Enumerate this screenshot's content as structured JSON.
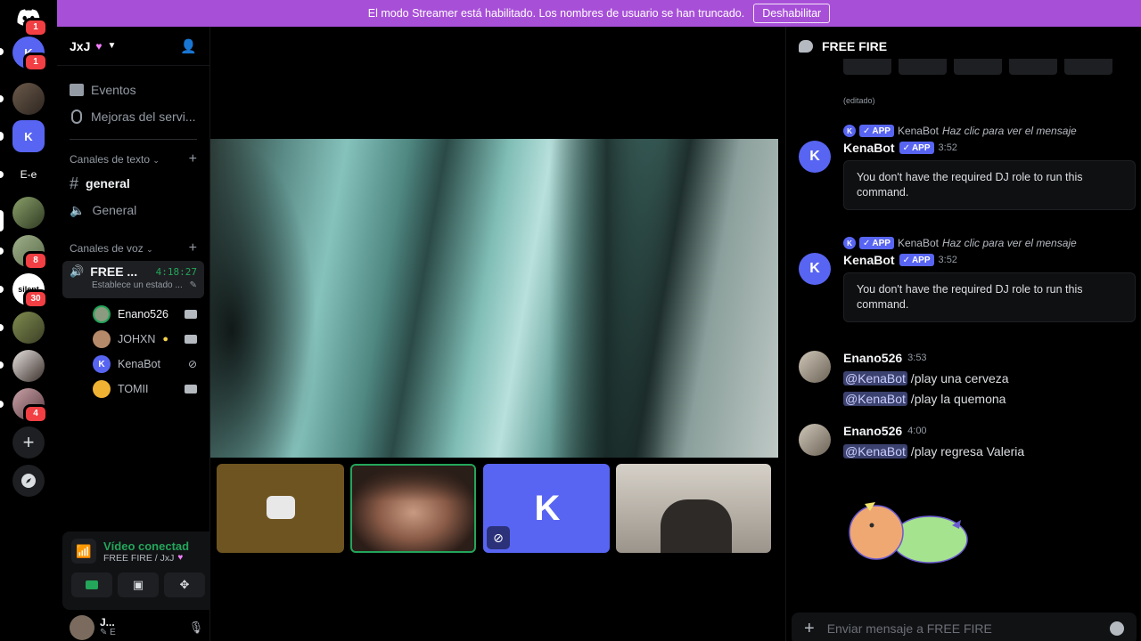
{
  "banner": {
    "text": "El modo Streamer está habilitado. Los nombres de usuario se han truncado.",
    "button": "Deshabilitar"
  },
  "rail": {
    "servers": [
      {
        "name": "discord-home",
        "badge": "1"
      },
      {
        "name": "kena-server",
        "badge": "1"
      },
      {
        "name": "server-photo-1",
        "badge": ""
      },
      {
        "name": "kena-active",
        "badge": ""
      },
      {
        "name": "e-e-server",
        "label": "E-e",
        "badge": ""
      },
      {
        "name": "server-photo-2",
        "badge": ""
      },
      {
        "name": "server-photo-3",
        "badge": "8"
      },
      {
        "name": "server-silent",
        "label": "silent",
        "badge": "30"
      },
      {
        "name": "server-photo-4",
        "badge": ""
      },
      {
        "name": "server-photo-5",
        "badge": ""
      },
      {
        "name": "server-photo-6",
        "badge": "4"
      }
    ]
  },
  "sidebar": {
    "guild_name": "JxJ",
    "events": "Eventos",
    "boosts": "Mejoras del servi...",
    "text_category": "Canales de texto",
    "text_channels": [
      {
        "name": "general"
      },
      {
        "name": "General"
      }
    ],
    "voice_category": "Canales de voz",
    "voice_channel": {
      "name": "FREE ...",
      "timer": "4:18:27",
      "status": "Establece un estado ..."
    },
    "voice_users": [
      {
        "name": "Enano526"
      },
      {
        "name": "JOHXN"
      },
      {
        "name": "KenaBot"
      },
      {
        "name": "TOMII"
      }
    ],
    "voice_panel": {
      "title": "Vídeo conectad",
      "subtitle": "FREE FIRE / JxJ"
    },
    "user": {
      "name": "J...",
      "status": "✎ E"
    }
  },
  "chat": {
    "channel": "FREE FIRE",
    "edited": "(editado)",
    "messages": [
      {
        "reply_name": "KenaBot",
        "reply_text": "Haz clic para ver el mensaje",
        "author": "KenaBot",
        "app": "APP",
        "time": "3:52",
        "embed": "You don't have the required DJ role to run this command."
      },
      {
        "reply_name": "KenaBot",
        "reply_text": "Haz clic para ver el mensaje",
        "author": "KenaBot",
        "app": "APP",
        "time": "3:52",
        "embed": "You don't have the required DJ role to run this command."
      },
      {
        "author": "Enano526",
        "time": "3:53",
        "lines": [
          {
            "mention": "@KenaBot",
            "text": " /play una cerveza"
          },
          {
            "mention": "@KenaBot",
            "text": " /play la quemona"
          }
        ]
      },
      {
        "author": "Enano526",
        "time": "4:00",
        "lines": [
          {
            "mention": "@KenaBot",
            "text": " /play regresa Valeria"
          }
        ]
      }
    ],
    "composer_placeholder": "Enviar mensaje a FREE FIRE"
  },
  "colors": {
    "banner": "#a84fd8",
    "brand": "#5865f2",
    "connected_green": "#23a55a",
    "badge_red": "#f23f43"
  }
}
